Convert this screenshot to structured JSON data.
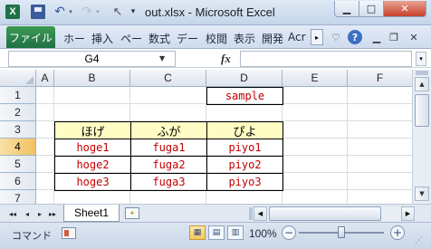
{
  "window": {
    "title": "out.xlsx - Microsoft Excel",
    "icon": "excel-app-icon",
    "buttons": [
      "minimize",
      "maximize",
      "close"
    ]
  },
  "qat": {
    "icons": [
      "save-icon",
      "undo-icon",
      "redo-icon",
      "cursor-icon",
      "customize-qat-icon"
    ]
  },
  "ribbon": {
    "file_tab": "ファイル",
    "tabs": [
      "ホー",
      "挿入",
      "ペー",
      "数式",
      "デー",
      "校閲",
      "表示",
      "開発",
      "Acr"
    ],
    "scroll_glyph": "▸",
    "help_glyph": "?"
  },
  "formula_bar": {
    "name_box": "G4",
    "fx_label": "fx",
    "formula": ""
  },
  "grid": {
    "columns": [
      "A",
      "B",
      "C",
      "D",
      "E",
      "F"
    ],
    "rows": [
      "1",
      "2",
      "3",
      "4",
      "5",
      "6",
      "7"
    ],
    "selected_column": "G",
    "selected_row": "4",
    "cells": {
      "D1": "sample",
      "B3": "ほげ",
      "C3": "ふが",
      "D3": "ぴよ",
      "B4": "hoge1",
      "C4": "fuga1",
      "D4": "piyo1",
      "B5": "hoge2",
      "C5": "fuga2",
      "D5": "piyo2",
      "B6": "hoge3",
      "C6": "fuga3",
      "D6": "piyo3"
    },
    "colors": {
      "header_fill": "#fffdc3",
      "data_text": "#c00000",
      "selection_header": "#f1c15f"
    }
  },
  "sheet_tabs": {
    "active": "Sheet1",
    "nav_glyphs": [
      "◂◂",
      "◂",
      "▸",
      "▸▸"
    ]
  },
  "status_bar": {
    "mode": "コマンド",
    "zoom": "100%",
    "zoom_minus": "−",
    "zoom_plus": "+"
  }
}
